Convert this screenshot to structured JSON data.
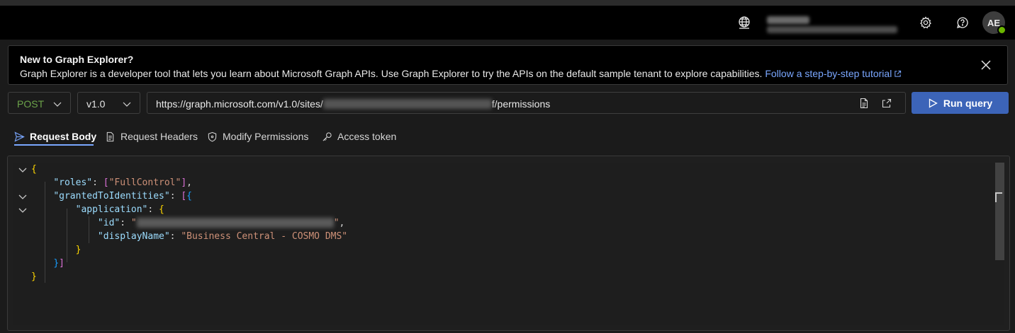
{
  "header": {
    "language_icon": "globe-icon",
    "settings_icon": "gear-icon",
    "help_icon": "help-icon",
    "avatar_initials": "AE",
    "status_color": "#6bb700"
  },
  "banner": {
    "title": "New to Graph Explorer?",
    "text": "Graph Explorer is a developer tool that lets you learn about Microsoft Graph APIs. Use Graph Explorer to try the APIs on the default sample tenant to explore capabilities. ",
    "link": "Follow a step-by-step tutorial"
  },
  "query": {
    "method": "POST",
    "version": "v1.0",
    "url_prefix": "https://graph.microsoft.com/v1.0/sites/",
    "url_suffix": "f/permissions",
    "run_label": "Run query",
    "accent_color": "#3c64b8"
  },
  "tabs": [
    {
      "label": "Request Body",
      "active": true
    },
    {
      "label": "Request Headers",
      "active": false
    },
    {
      "label": "Modify Permissions",
      "active": false
    },
    {
      "label": "Access token",
      "active": false
    }
  ],
  "body": {
    "open_brace": "{",
    "roles_key": "\"roles\"",
    "roles_value": "\"FullControl\"",
    "granted_key": "\"grantedToIdentities\"",
    "application_key": "\"application\"",
    "id_key": "\"id\"",
    "display_name_key": "\"displayName\"",
    "display_name_value": "\"Business Central - COSMO DMS\"",
    "close_brace": "}"
  }
}
